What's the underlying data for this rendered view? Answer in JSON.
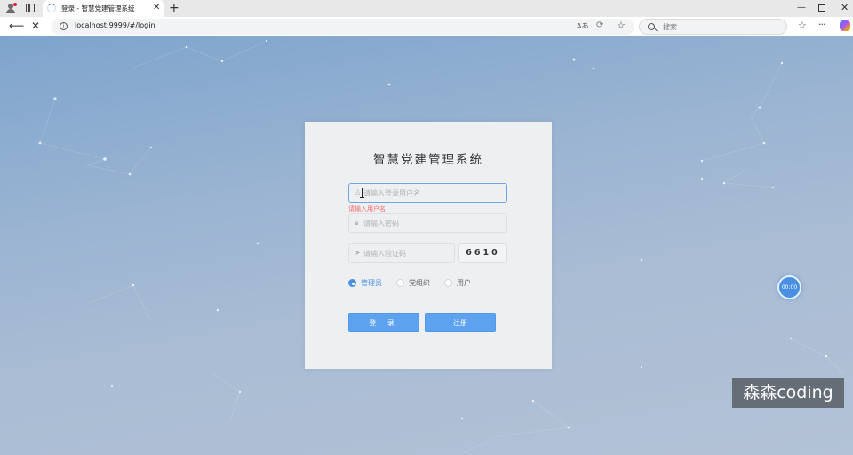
{
  "browser": {
    "tab_title": "登录 - 智慧党建管理系统",
    "tab_close": "✕",
    "new_tab": "+",
    "url": "localhost:9999/#/login",
    "read_aloud": "Aあ",
    "search_placeholder": "搜索",
    "window_min": "—",
    "window_close": "✕"
  },
  "login": {
    "title": "智慧党建管理系统",
    "username_placeholder": "请输入登录用户名",
    "username_error": "请输入用户名",
    "password_placeholder": "请输入密码",
    "captcha_placeholder": "请输入验证码",
    "captcha_code": "6610",
    "roles": [
      {
        "label": "管理员",
        "checked": true
      },
      {
        "label": "党组织",
        "checked": false
      },
      {
        "label": "用户",
        "checked": false
      }
    ],
    "login_button": "登 录",
    "register_button": "注册"
  },
  "timer": {
    "text": "00:00"
  },
  "watermark": {
    "text": "森森coding"
  },
  "colors": {
    "accent": "#5da2ee",
    "error": "#f56c6c",
    "background_top": "#7ea4cd",
    "background_bottom": "#b3c2d6"
  }
}
